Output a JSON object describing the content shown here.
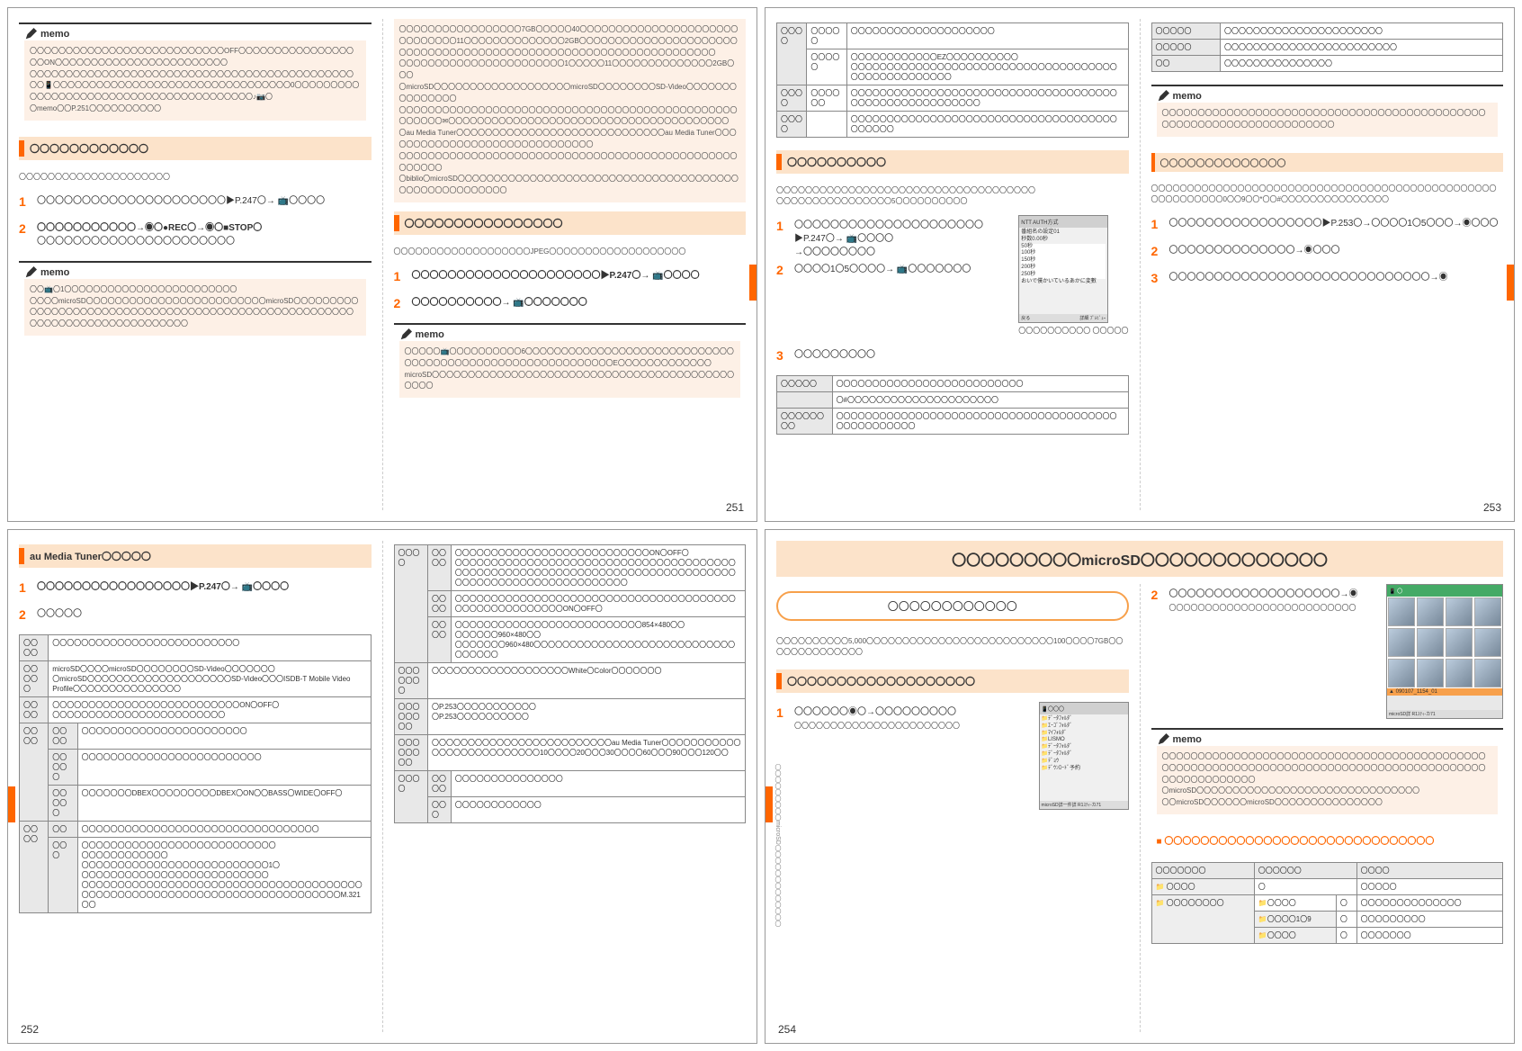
{
  "pages": {
    "p251": {
      "memo1": {
        "label": "memo",
        "body": "〇〇〇〇〇〇〇〇〇〇〇〇〇〇〇〇〇〇〇〇〇〇〇〇〇〇〇OFF〇〇〇〇〇〇〇〇〇〇〇〇〇〇〇〇〇〇ON〇〇〇〇〇〇〇〇〇〇〇〇〇〇〇〇〇〇〇〇〇〇〇〇\n〇〇〇〇〇〇〇〇〇〇〇〇〇〇〇〇〇〇〇〇〇〇〇〇〇〇〇〇〇〇〇〇〇〇〇〇〇〇〇〇〇〇〇〇〇〇〇📱〇〇〇〇〇〇〇〇〇〇〇〇〇〇〇〇〇〇〇〇〇〇〇〇〇〇〇〇〇〇〇〇〇0〇〇〇〇〇〇〇〇〇〇〇〇〇〇〇〇〇〇〇〇〇〇〇〇〇〇〇〇〇〇〇〇〇〇〇〇〇〇〇〇♪📷〇\n〇memo〇〇P.251〇〇〇〇〇〇〇〇〇〇"
      },
      "section1": "〇〇〇〇〇〇〇〇〇〇〇〇",
      "section1_sub": "〇〇〇〇〇〇〇〇〇〇〇〇〇〇〇〇〇〇〇〇〇",
      "step1_1": "〇〇〇〇〇〇〇〇〇〇〇〇〇〇〇〇〇〇〇〇〇▶P.247〇→ 📺〇〇〇〇",
      "step1_2": "〇〇〇〇〇〇〇〇〇〇〇→◉〇●REC〇→◉〇■STOP〇",
      "step1_2_sub": "〇〇〇〇〇〇〇〇〇〇〇〇〇〇〇〇〇〇〇〇〇〇",
      "memo2": {
        "label": "memo",
        "body": "〇〇📺〇1〇〇〇〇〇〇〇〇〇〇〇〇〇〇〇〇〇〇〇〇〇〇〇〇\n〇〇〇〇microSD〇〇〇〇〇〇〇〇〇〇〇〇〇〇〇〇〇〇〇〇〇〇〇〇〇microSD〇〇〇〇〇〇〇〇〇〇〇〇〇〇〇〇〇〇〇〇〇〇〇〇〇〇〇〇〇〇〇〇〇〇〇〇〇〇〇〇〇〇〇〇〇〇〇〇〇〇〇〇〇〇〇〇〇〇〇〇〇〇〇〇〇〇〇〇〇〇〇〇〇〇〇〇"
      },
      "right_notes": "〇〇〇〇〇〇〇〇〇〇〇〇〇〇〇〇〇7GB〇〇〇〇〇40〇〇〇〇〇〇〇〇〇〇〇〇〇〇〇〇〇〇〇〇〇〇〇〇〇〇〇〇〇〇11〇〇〇〇〇〇〇〇〇〇〇〇〇〇2GB〇〇〇〇〇〇〇〇〇〇〇〇〇〇〇〇〇〇〇〇〇〇〇〇〇〇〇〇〇〇〇〇〇〇〇〇〇〇〇〇〇〇〇〇〇〇〇〇〇〇〇〇〇〇〇〇〇〇〇〇〇〇〇〇〇〇\n〇〇〇〇〇〇〇〇〇〇〇〇〇〇〇〇〇〇〇〇〇〇〇1〇〇〇〇〇11〇〇〇〇〇〇〇〇〇〇〇〇〇〇2GB〇〇〇\n〇microSD〇〇〇〇〇〇〇〇〇〇〇〇〇〇〇〇〇〇〇microSD〇〇〇〇〇〇〇〇SD-Video〇〇〇〇〇〇〇〇〇〇〇〇〇〇〇\n〇〇〇〇〇〇〇〇〇〇〇〇〇〇〇〇〇〇〇〇〇〇〇〇〇〇〇〇〇〇〇〇〇〇〇〇〇〇〇〇〇〇〇〇〇〇〇〇〇〇〇〇〇✉〇〇〇〇〇〇〇〇〇〇〇〇〇〇〇〇〇〇〇〇〇〇〇〇〇〇〇〇〇〇〇〇〇〇〇〇〇〇〇\n〇au Media Tuner〇〇〇〇〇〇〇〇〇〇〇〇〇〇〇〇〇〇〇〇〇〇〇〇〇〇〇〇〇au Media Tuner〇〇〇〇〇〇〇〇〇〇〇〇〇〇〇〇〇〇〇〇〇〇〇〇〇〇〇〇〇〇\n〇〇〇〇〇〇〇〇〇〇〇〇〇〇〇〇〇〇〇〇〇〇〇〇〇〇〇〇〇〇〇〇〇〇〇〇〇〇〇〇〇〇〇〇〇〇〇〇〇〇〇〇〇\n〇biblio〇microSD〇〇〇〇〇〇〇〇〇〇〇〇〇〇〇〇〇〇〇〇〇〇〇〇〇〇〇〇〇〇〇〇〇〇〇〇〇〇〇〇〇〇〇〇〇〇〇〇〇〇〇〇〇〇",
      "section2": "〇〇〇〇〇〇〇〇〇〇〇〇〇〇〇〇",
      "section2_sub": "〇〇〇〇〇〇〇〇〇〇〇〇〇〇〇〇〇〇〇JPEG〇〇〇〇〇〇〇〇〇〇〇〇〇〇〇〇〇〇〇",
      "step2_1": "〇〇〇〇〇〇〇〇〇〇〇〇〇〇〇〇〇〇〇〇〇▶P.247〇→ 📺〇〇〇〇",
      "step2_2": "〇〇〇〇〇〇〇〇〇〇→ 📺〇〇〇〇〇〇〇",
      "memo3": {
        "label": "memo",
        "body": "〇〇〇〇〇📺〇〇〇〇〇〇〇〇〇〇6〇〇〇〇〇〇〇〇〇〇〇〇〇〇〇〇〇〇〇〇〇〇〇〇〇〇〇〇〇〇〇〇〇〇〇〇〇〇〇〇〇〇〇〇〇〇〇〇〇〇〇〇〇〇〇〇〇〇E〇〇〇〇〇〇〇〇〇〇〇〇〇microSD〇〇〇〇〇〇〇〇〇〇〇〇〇〇〇〇〇〇〇〇〇〇〇〇〇〇〇〇〇〇〇〇〇〇〇〇〇〇〇〇〇〇〇〇〇〇"
      },
      "num": "251"
    },
    "p253": {
      "table1": {
        "rows": [
          [
            "〇〇〇〇",
            "〇〇〇〇〇",
            "〇〇〇〇〇〇〇〇〇〇〇〇〇〇〇〇〇〇〇〇"
          ],
          [
            "",
            "〇〇〇〇〇",
            "〇〇〇〇〇〇〇〇〇〇〇〇EZ〇〇〇〇〇〇〇〇〇〇\n〇〇〇〇〇〇〇〇〇〇〇〇〇〇〇〇〇〇〇〇〇〇〇〇〇〇〇〇〇〇〇〇〇〇〇〇〇〇〇〇〇〇〇〇〇〇〇〇〇〇〇"
          ],
          [
            "〇〇〇〇",
            "〇〇〇〇〇〇",
            "〇〇〇〇〇〇〇〇〇〇〇〇〇〇〇〇〇〇〇〇〇〇〇〇〇〇〇〇〇〇〇〇〇〇〇〇〇〇〇〇〇〇〇〇〇〇〇〇〇〇〇〇〇〇〇"
          ],
          [
            "〇〇〇〇",
            "",
            "〇〇〇〇〇〇〇〇〇〇〇〇〇〇〇〇〇〇〇〇〇〇〇〇〇〇〇〇〇〇〇〇〇〇〇〇〇〇〇〇〇〇〇"
          ]
        ]
      },
      "section1": "〇〇〇〇〇〇〇〇〇〇",
      "section1_sub": "〇〇〇〇〇〇〇〇〇〇〇〇〇〇〇〇〇〇〇〇〇〇〇〇〇〇〇〇〇〇〇〇〇〇〇〇\n〇〇〇〇〇〇〇〇〇〇〇〇〇〇〇〇5〇〇〇〇〇〇〇〇〇〇",
      "step1": "〇〇〇〇〇〇〇〇〇〇〇〇〇〇〇〇〇〇〇〇〇▶P.247〇→ 📺〇〇〇〇\n→〇〇〇〇〇〇〇〇",
      "step2": "〇〇〇〇1〇5〇〇〇〇→ 📺〇〇〇〇〇〇〇",
      "shot1": {
        "title": "NTT AUTH方式",
        "lines": [
          "番組名の設定01",
          "秒数0.00秒",
          "50秒",
          "100秒",
          "150秒",
          "200秒",
          "250秒",
          "おいで僕かいているあかに変數"
        ],
        "footer_l": "戻る",
        "footer_r": "詳細 ﾌﾟﾚﾋﾞｭｰ"
      },
      "shot_caption": "〇〇〇〇〇〇〇〇〇〇\n〇〇〇〇〇",
      "step3": "〇〇〇〇〇〇〇〇〇",
      "table2": {
        "rows": [
          [
            "〇〇〇〇〇",
            "〇〇〇〇〇〇〇〇〇〇〇〇〇〇〇〇〇〇〇〇〇〇〇〇〇〇"
          ],
          [
            "",
            "〇#〇〇〇〇〇〇〇〇〇〇〇〇〇〇〇〇〇〇〇〇〇"
          ],
          [
            "〇〇〇〇〇〇〇〇",
            "〇〇〇〇〇〇〇〇〇〇〇〇〇〇〇〇〇〇〇〇〇〇〇〇〇〇〇〇〇〇〇〇〇〇〇〇〇〇〇〇〇〇〇〇〇〇〇〇〇〇"
          ]
        ]
      },
      "right_table": {
        "rows": [
          [
            "〇〇〇〇〇",
            "〇〇〇〇〇〇〇〇〇〇〇〇〇〇〇〇〇〇〇〇〇〇"
          ],
          [
            "〇〇〇〇〇",
            "〇〇〇〇〇〇〇〇〇〇〇〇〇〇〇〇〇〇〇〇〇〇〇〇"
          ],
          [
            "〇〇",
            "〇〇〇〇〇〇〇〇〇〇〇〇〇〇〇"
          ]
        ]
      },
      "memo1": {
        "label": "memo",
        "body": "〇〇〇〇〇〇〇〇〇〇〇〇〇〇〇〇〇〇〇〇〇〇〇〇〇〇〇〇〇〇〇〇〇〇〇〇〇〇〇〇〇〇〇〇〇〇〇〇〇〇〇〇〇〇〇〇〇〇〇〇〇〇〇〇〇〇〇〇〇"
      },
      "sub_band": "〇〇〇〇〇〇〇〇〇〇〇〇〇〇",
      "right_notes": "〇〇〇〇〇〇〇〇〇〇〇〇〇〇〇〇〇〇〇〇〇〇〇〇〇〇〇〇〇〇〇〇〇〇〇〇〇〇〇〇〇〇〇〇〇〇〇〇〇〇〇〇〇〇〇〇〇〇0〇〇9〇〇*〇〇#〇〇〇〇〇〇〇〇〇〇〇〇〇〇〇",
      "rstep1": "〇〇〇〇〇〇〇〇〇〇〇〇〇〇〇〇〇▶P.253〇→〇〇〇〇1〇5〇〇〇→◉〇〇〇",
      "rstep2": "〇〇〇〇〇〇〇〇〇〇〇〇〇〇→◉〇〇〇",
      "rstep3": "〇〇〇〇〇〇〇〇〇〇〇〇〇〇〇〇〇〇〇〇〇〇〇〇〇〇〇〇〇→◉",
      "num": "253"
    },
    "p252": {
      "section1": "au Media Tuner〇〇〇〇〇",
      "step1": "〇〇〇〇〇〇〇〇〇〇〇〇〇〇〇〇〇▶P.247〇→ 📺〇〇〇〇",
      "step2": "〇〇〇〇〇",
      "table1": {
        "rows": [
          [
            "〇〇〇〇",
            "",
            "〇〇〇〇〇〇〇〇〇〇〇〇〇〇〇〇〇〇〇〇〇〇〇〇〇〇"
          ],
          [
            "〇〇〇〇〇",
            "",
            "microSD〇〇〇〇microSD〇〇〇〇〇〇〇〇SD-Video〇〇〇〇〇〇〇\n〇microSD〇〇〇〇〇〇〇〇〇〇〇〇〇〇〇〇〇〇〇〇SD-Video〇〇〇ISDB-T Mobile Video Profile〇〇〇〇〇〇〇〇〇〇〇〇〇〇〇"
          ],
          [
            "〇〇〇〇",
            "",
            "〇〇〇〇〇〇〇〇〇〇〇〇〇〇〇〇〇〇〇〇〇〇〇〇〇〇ON〇OFF〇\n〇〇〇〇〇〇〇〇〇〇〇〇〇〇〇〇〇〇〇〇〇〇〇〇"
          ],
          [
            "〇〇〇〇",
            "〇〇〇〇",
            "〇〇〇〇〇〇〇〇〇〇〇〇〇〇〇〇〇〇〇〇〇〇〇"
          ],
          [
            "",
            "〇〇〇〇〇",
            "〇〇〇〇〇〇〇〇〇〇〇〇〇〇〇〇〇〇〇〇〇〇〇〇〇"
          ],
          [
            "",
            "〇〇〇〇〇",
            "〇〇〇〇〇〇〇DBEX〇〇〇〇〇〇〇〇〇DBEX〇ON〇〇BASS〇WIDE〇OFF〇"
          ],
          [
            "〇〇〇〇",
            "〇〇",
            "〇〇〇〇〇〇〇〇〇〇〇〇〇〇〇〇〇〇〇〇〇〇〇〇〇〇〇〇〇〇〇〇〇"
          ],
          [
            "",
            "〇〇〇",
            "〇〇〇〇〇〇〇〇〇〇〇〇〇〇〇〇〇〇〇〇〇〇〇〇〇〇〇\n〇〇〇〇〇〇〇〇〇〇〇〇\n〇〇〇〇〇〇〇〇〇〇〇〇〇〇〇〇〇〇〇〇〇〇〇〇〇〇1〇\n〇〇〇〇〇〇〇〇〇〇〇〇〇〇〇〇〇〇〇〇〇〇〇〇〇〇\n〇〇〇〇〇〇〇〇〇〇〇〇〇〇〇〇〇〇〇〇〇〇〇〇〇〇〇〇〇〇〇〇〇〇〇〇〇〇〇〇〇〇〇〇〇〇〇〇〇〇〇〇〇〇〇〇〇〇〇〇〇〇〇〇〇〇〇〇〇〇〇〇〇〇〇M.321〇〇"
          ]
        ]
      },
      "table2": {
        "rows": [
          [
            "〇〇〇〇",
            "〇〇〇〇",
            "〇〇〇〇〇〇〇〇〇〇〇〇〇〇〇〇〇〇〇〇〇〇〇〇〇〇〇ON〇OFF〇\n〇〇〇〇〇〇〇〇〇〇〇〇〇〇〇〇〇〇〇〇〇〇〇〇〇〇〇〇〇〇〇〇〇〇〇〇〇〇〇〇〇〇〇〇〇〇〇〇〇〇〇〇〇〇〇〇〇〇〇〇〇〇〇〇〇〇〇〇〇〇〇〇〇〇〇〇〇〇〇〇〇〇〇〇〇〇〇〇〇〇〇〇〇〇〇〇〇〇〇〇〇〇"
          ],
          [
            "",
            "〇〇〇〇",
            "〇〇〇〇〇〇〇〇〇〇〇〇〇〇〇〇〇〇〇〇〇〇〇〇〇〇〇〇〇〇〇〇〇〇〇〇〇〇〇〇〇〇〇〇〇〇〇〇〇〇〇〇〇〇ON〇OFF〇"
          ],
          [
            "",
            "〇〇〇〇",
            "〇〇〇〇〇〇〇〇〇〇〇〇〇〇〇〇〇〇〇〇〇〇〇〇〇〇854×480〇〇\n〇〇〇〇〇〇960×480〇〇\n〇〇〇〇〇〇〇960×480〇〇〇〇〇〇〇〇〇〇〇〇〇〇〇〇〇〇〇〇〇〇〇〇〇〇〇〇〇〇〇〇〇〇"
          ],
          [
            "〇〇〇〇〇〇〇",
            "",
            "〇〇〇〇〇〇〇〇〇〇〇〇〇〇〇〇〇〇〇White〇Color〇〇〇〇〇〇〇"
          ],
          [
            "〇〇〇〇〇〇〇〇",
            "",
            "〇P.253〇〇〇〇〇〇〇〇〇〇〇\n〇P.253〇〇〇〇〇〇〇〇〇〇"
          ],
          [
            "〇〇〇〇〇〇〇〇",
            "",
            "〇〇〇〇〇〇〇〇〇〇〇〇〇〇〇〇〇〇〇〇〇〇〇〇〇au Media Tuner〇〇〇〇〇〇〇〇〇〇〇〇〇〇〇〇〇〇〇〇〇〇〇〇〇〇10〇〇〇〇20〇〇〇30〇〇〇〇60〇〇〇90〇〇〇120〇〇"
          ],
          [
            "〇〇〇〇",
            "〇〇〇〇",
            "〇〇〇〇〇〇〇〇〇〇〇〇〇〇〇"
          ],
          [
            "",
            "〇〇〇",
            "〇〇〇〇〇〇〇〇〇〇〇〇"
          ]
        ]
      },
      "num": "252"
    },
    "p254": {
      "title": "〇〇〇〇〇〇〇〇〇microSD〇〇〇〇〇〇〇〇〇〇〇〇〇",
      "subtitle": "〇〇〇〇〇〇〇〇〇〇〇〇",
      "intro": "〇〇〇〇〇〇〇〇〇〇5,000〇〇〇〇〇〇〇〇〇〇〇〇〇〇〇〇〇〇〇〇〇〇〇〇〇〇100〇〇〇〇7GB〇〇〇〇〇〇〇〇〇〇〇〇〇〇",
      "section1": "〇〇〇〇〇〇〇〇〇〇〇〇〇〇〇〇〇〇〇",
      "step1": "〇〇〇〇〇〇◉〇→〇〇〇〇〇〇〇〇〇",
      "step1_sub": "〇〇〇〇〇〇〇〇〇〇〇〇〇〇〇〇〇〇〇〇〇〇〇",
      "shot1": {
        "title": "📱〇〇〇",
        "lines": [
          "📁ﾃﾞｰﾀﾌｫﾙﾀﾞ",
          "📁ｴｰｺﾞﾌｫﾙﾀﾞ",
          "📁ﾏｲﾌｫﾙﾀﾞ",
          "📁LISMO",
          "📁ﾃﾞｰﾀﾌｫﾙﾀﾞ",
          "📁ﾃﾞｰﾀﾌｫﾙﾀﾞ",
          "📁ﾃﾞｮｳ",
          "📁ﾃﾞｳﾝﾛｰﾄﾞ予約"
        ],
        "footer": "microSD詳一件詳 R1ｽﾃｨ-カ71"
      },
      "step2": "〇〇〇〇〇〇〇〇〇〇〇〇〇〇〇〇〇〇〇→◉",
      "step2_sub": "〇〇〇〇〇〇〇〇〇〇〇〇〇〇〇〇〇〇〇〇〇〇〇〇〇〇",
      "thumbs": {
        "header": "📱 〇",
        "info": "▲ 090107_1154_01",
        "footer": "microSD詳 R1ｽﾃｨ-カ71"
      },
      "memo1": {
        "label": "memo",
        "body": "〇〇〇〇〇〇〇〇〇〇〇〇〇〇〇〇〇〇〇〇〇〇〇〇〇〇〇〇〇〇〇〇〇〇〇〇〇〇〇〇〇〇〇〇〇〇〇〇〇〇〇〇〇〇〇〇〇〇〇〇〇〇〇〇〇〇〇〇〇〇〇〇〇〇〇〇〇〇〇〇〇〇〇〇〇〇〇〇〇〇〇〇〇〇〇〇〇〇〇〇〇〇〇\n〇microSD〇〇〇〇〇〇〇〇〇〇〇〇〇〇〇〇〇〇〇〇〇〇〇〇〇〇〇〇〇〇〇\n〇〇microSD〇〇〇〇〇〇microSD〇〇〇〇〇〇〇〇〇〇〇〇〇〇〇"
      },
      "sub_band": "■ 〇〇〇〇〇〇〇〇〇〇〇〇〇〇〇〇〇〇〇〇〇〇〇〇〇〇〇〇〇〇",
      "table1": {
        "head": [
          "〇〇〇〇〇〇〇",
          "〇〇〇〇〇〇",
          "",
          "〇〇〇〇"
        ],
        "rows": [
          [
            "📁 〇〇〇〇",
            "",
            "〇",
            "〇〇〇〇〇"
          ],
          [
            "📁 〇〇〇〇〇〇〇〇",
            "📁〇〇〇〇",
            "〇",
            "〇〇〇〇〇〇〇〇〇〇〇〇〇〇"
          ],
          [
            "",
            "📁〇〇〇〇1〇9",
            "〇",
            "〇〇〇〇〇〇〇〇〇"
          ],
          [
            "",
            "📁〇〇〇〇",
            "〇",
            "〇〇〇〇〇〇〇"
          ]
        ]
      },
      "vert": "〇〇〇〇〇〇〇〇〇microSD〇〇〇〇〇〇〇〇〇〇〇〇〇",
      "num": "254"
    }
  }
}
